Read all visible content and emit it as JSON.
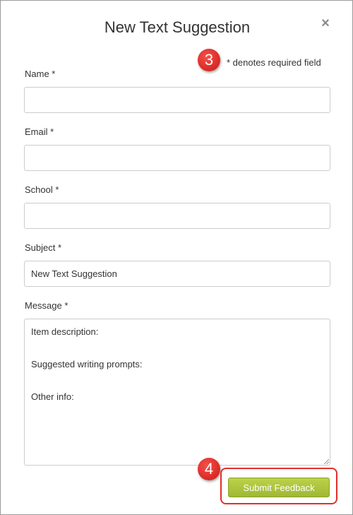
{
  "dialog": {
    "title": "New Text Suggestion",
    "close_symbol": "×",
    "required_note": "* denotes required field"
  },
  "callouts": {
    "step_required": "3",
    "step_submit": "4"
  },
  "fields": {
    "name": {
      "label": "Name *",
      "value": ""
    },
    "email": {
      "label": "Email *",
      "value": ""
    },
    "school": {
      "label": "School *",
      "value": ""
    },
    "subject": {
      "label": "Subject *",
      "value": "New Text Suggestion"
    }
  },
  "message": {
    "label": "Message *",
    "lines": [
      "Item description:",
      "Suggested writing prompts:",
      "Other info:"
    ]
  },
  "submit": {
    "label": "Submit Feedback"
  },
  "colors": {
    "accent_green": "#a8c13c",
    "callout_red": "#e0302b"
  },
  "icons": [
    "close-icon",
    "resize-grip-icon"
  ]
}
